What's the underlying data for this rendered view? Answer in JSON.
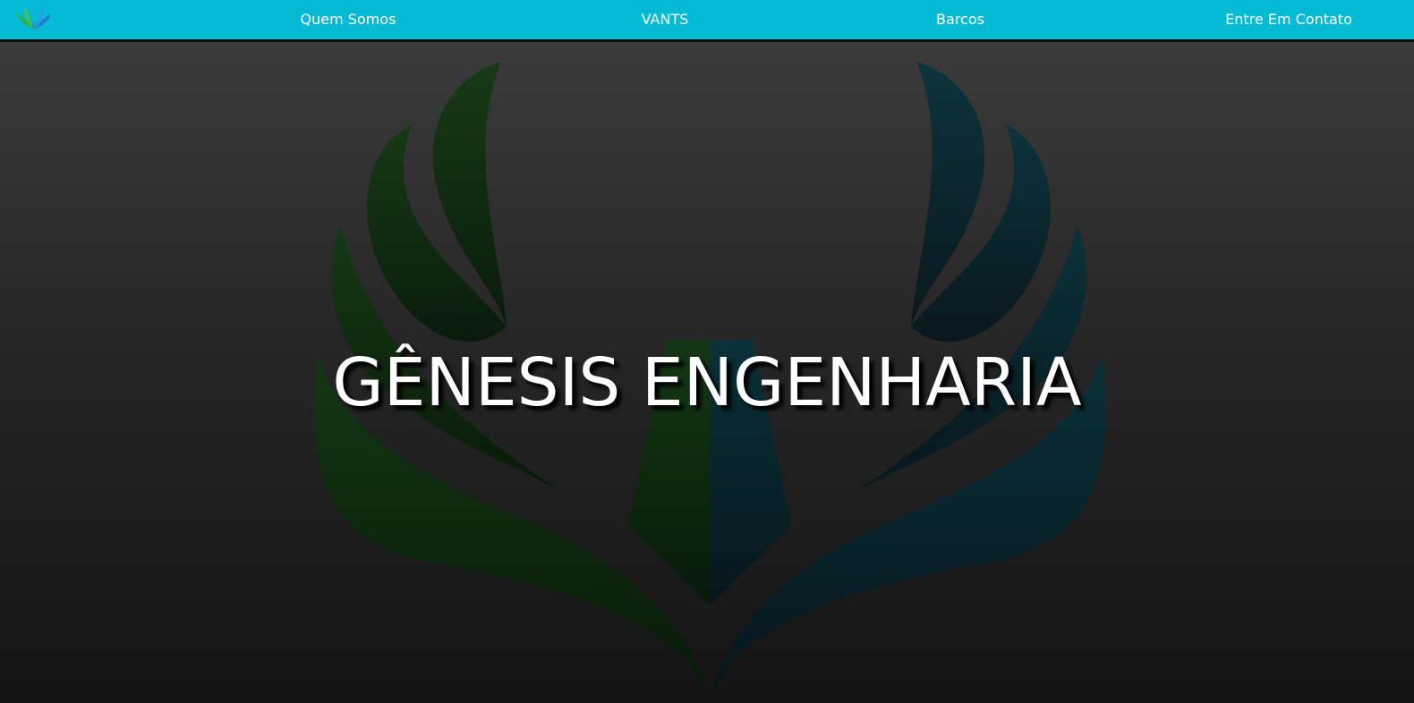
{
  "navbar": {
    "background": "#04bbd6",
    "logo_icon": "genesis-wings-logo-icon",
    "links": [
      {
        "label": "Quem Somos"
      },
      {
        "label": "VANTS"
      },
      {
        "label": "Barcos"
      },
      {
        "label": "Entre Em Contato"
      }
    ]
  },
  "hero": {
    "title": "GÊNESIS ENGENHARIA",
    "background_icon": "genesis-wings-emblem-icon",
    "title_color": "#ffffff",
    "green_accent": "#0f3d10",
    "blue_accent": "#06303a"
  }
}
